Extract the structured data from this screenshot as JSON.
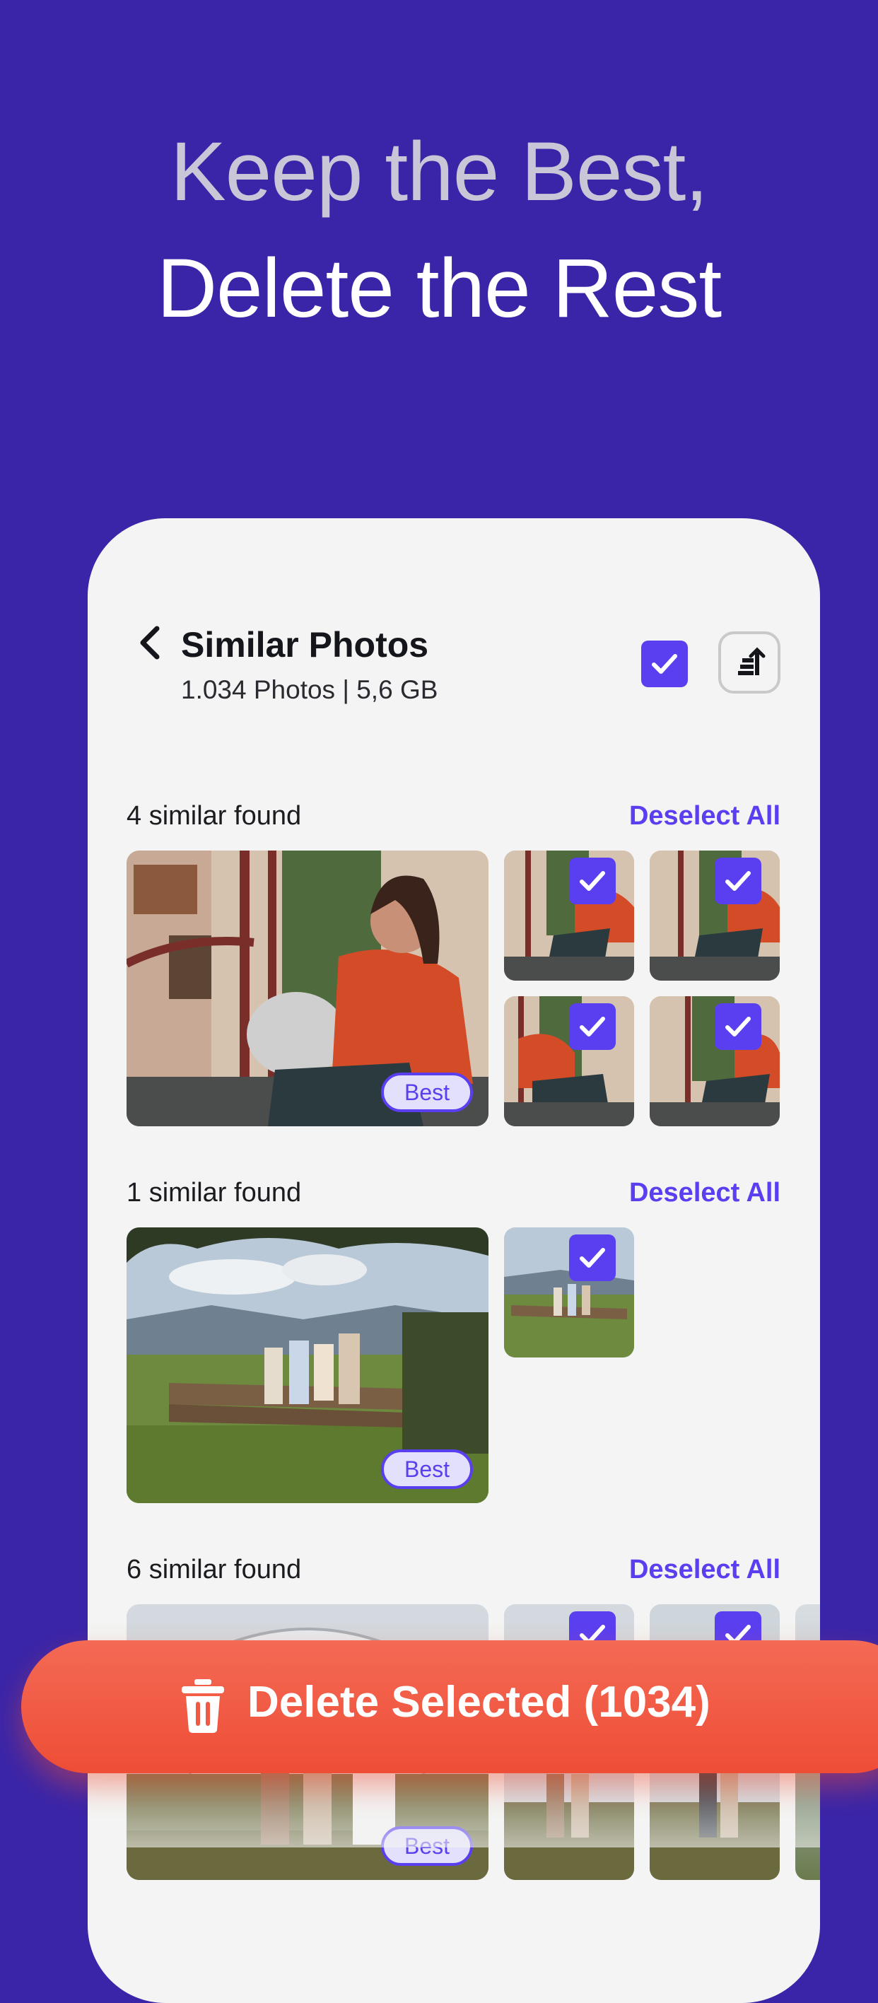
{
  "headline": {
    "line1": "Keep the Best,",
    "line2": "Delete the Rest"
  },
  "header": {
    "title": "Similar Photos",
    "subtitle": "1.034 Photos | 5,6 GB"
  },
  "groups": [
    {
      "label": "4 similar found",
      "action": "Deselect All",
      "best_label": "Best"
    },
    {
      "label": "1 similar found",
      "action": "Deselect All",
      "best_label": "Best"
    },
    {
      "label": "6 similar found",
      "action": "Deselect All",
      "best_label": "Best"
    }
  ],
  "delete_button": {
    "label": "Delete Selected (1034)"
  },
  "icons": {
    "back": "chevron-left-icon",
    "select_all": "checkbox-checked-icon",
    "sort": "sort-icon",
    "delete": "trash-icon"
  },
  "colors": {
    "background": "#3a25a8",
    "accent": "#5a3ff0",
    "danger": "#ee4d36"
  }
}
